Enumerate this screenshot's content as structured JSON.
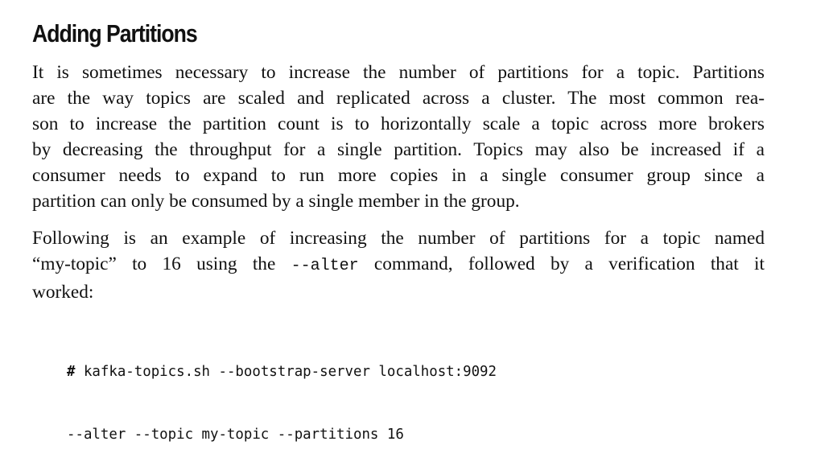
{
  "section": {
    "heading": "Adding Partitions"
  },
  "paragraph1": {
    "lines": [
      "It is sometimes necessary to increase the number of partitions for a topic. Partitions",
      "are the way topics are scaled and replicated across a cluster. The most common rea-",
      "son to increase the partition count is to horizontally scale a topic across more brokers",
      "by decreasing the throughput for a single partition. Topics may also be increased if a",
      "consumer needs to expand to run more copies in a single consumer group since a",
      "partition can only be consumed by a single member in the group."
    ]
  },
  "paragraph2": {
    "line1": "Following is an example of increasing the number of partitions for a topic named",
    "line2_pre": "“my-topic” to 16 using the ",
    "line2_code": "--alter",
    "line2_post": " command, followed by a verification that it",
    "line3": "worked:"
  },
  "code": {
    "prompt": "#",
    "line1": " kafka-topics.sh --bootstrap-server localhost:9092",
    "line2": "--alter --topic my-topic --partitions 16"
  }
}
